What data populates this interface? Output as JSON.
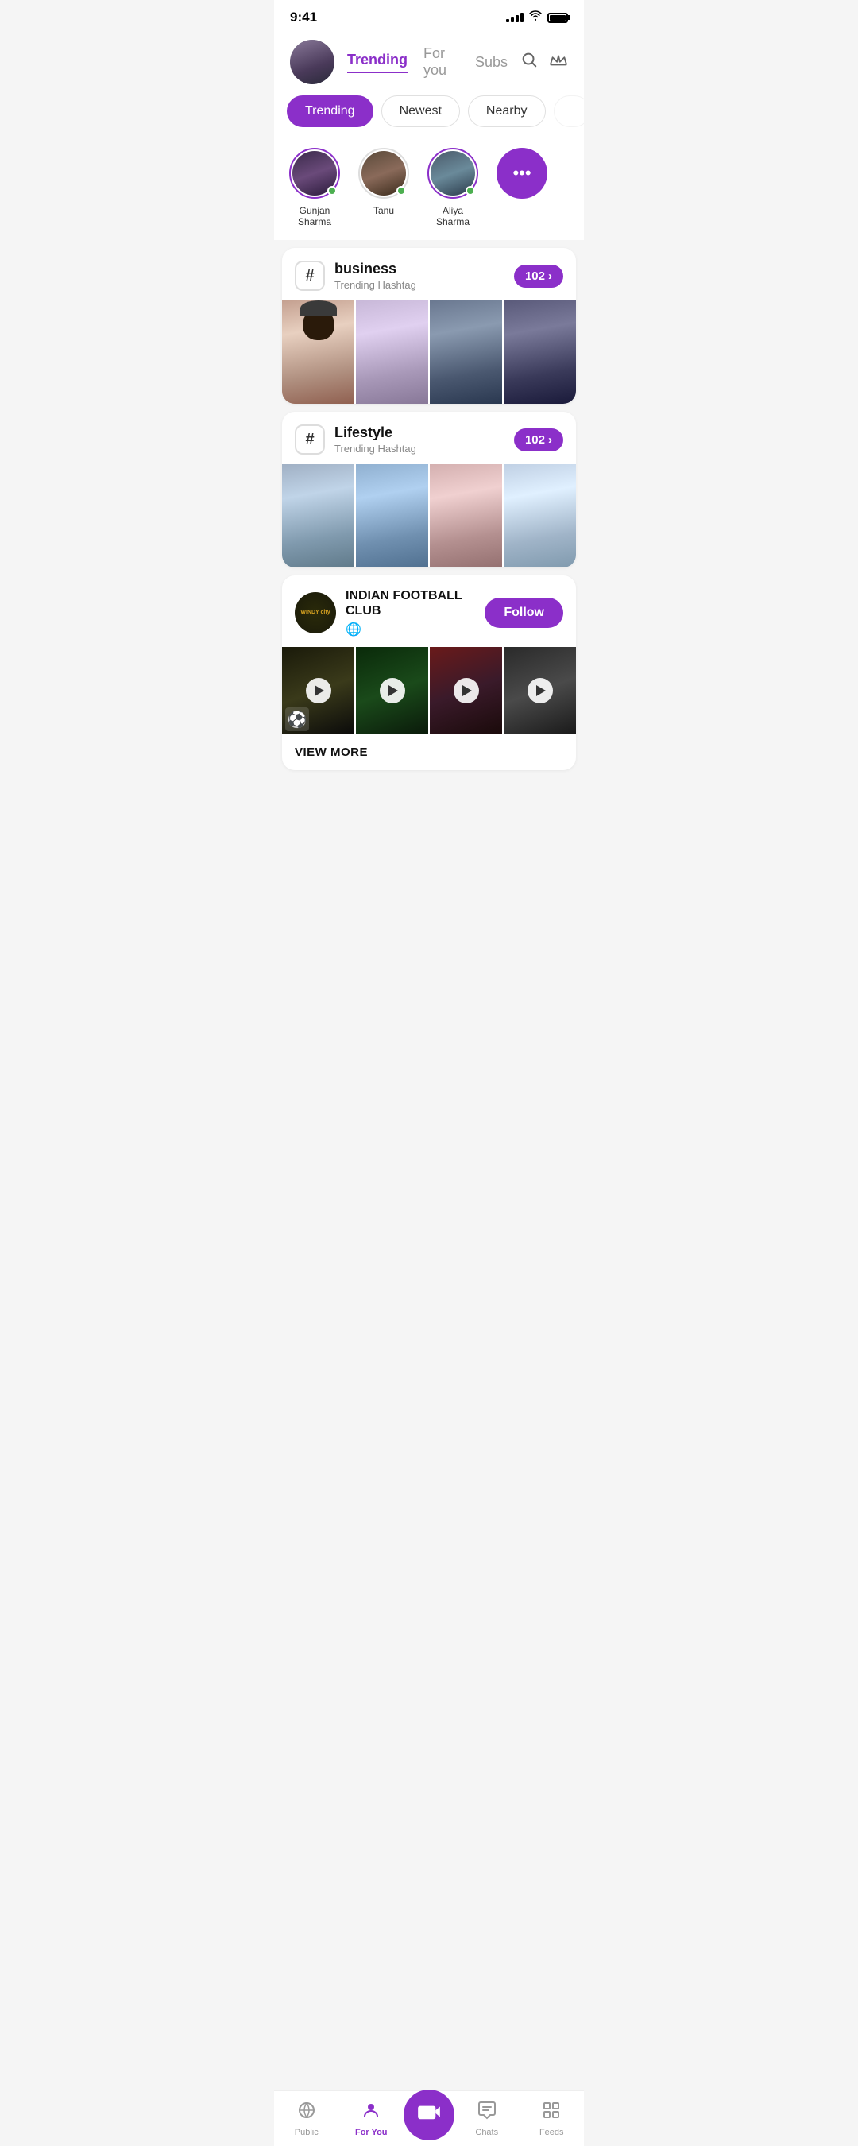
{
  "status": {
    "time": "9:41",
    "signal_levels": [
      3,
      5,
      7,
      9,
      11
    ],
    "battery_pct": 90
  },
  "header": {
    "tabs": [
      {
        "id": "trending",
        "label": "Trending",
        "active": true
      },
      {
        "id": "foryou",
        "label": "For you",
        "active": false
      },
      {
        "id": "subs",
        "label": "Subs",
        "active": false
      }
    ],
    "search_label": "search",
    "crown_label": "crown"
  },
  "filters": [
    {
      "id": "trending",
      "label": "Trending",
      "active": true
    },
    {
      "id": "newest",
      "label": "Newest",
      "active": false
    },
    {
      "id": "nearby",
      "label": "Nearby",
      "active": false
    }
  ],
  "stories": [
    {
      "name": "Gunjan Sharma",
      "online": true
    },
    {
      "name": "Tanu",
      "online": true
    },
    {
      "name": "Aliya Sharma",
      "online": true
    },
    {
      "name": "more",
      "online": false
    }
  ],
  "hashtags": [
    {
      "name": "business",
      "sub": "Trending Hashtag",
      "count": "102"
    },
    {
      "name": "Lifestyle",
      "sub": "Trending Hashtag",
      "count": "102"
    }
  ],
  "club": {
    "logo_text": "WINDY city",
    "name": "INDIAN FOOTBALL CLUB",
    "follow_label": "Follow",
    "view_more_label": "VIEW MORE"
  },
  "bottom_nav": [
    {
      "id": "public",
      "label": "Public",
      "icon": "📡",
      "active": false
    },
    {
      "id": "foryou",
      "label": "For You",
      "icon": "👤",
      "active": true
    },
    {
      "id": "golive",
      "label": "Go Live",
      "icon": "🎥",
      "active": false,
      "center": true
    },
    {
      "id": "chats",
      "label": "Chats",
      "icon": "💬",
      "active": false
    },
    {
      "id": "feeds",
      "label": "Feeds",
      "icon": "☰",
      "active": false
    }
  ]
}
